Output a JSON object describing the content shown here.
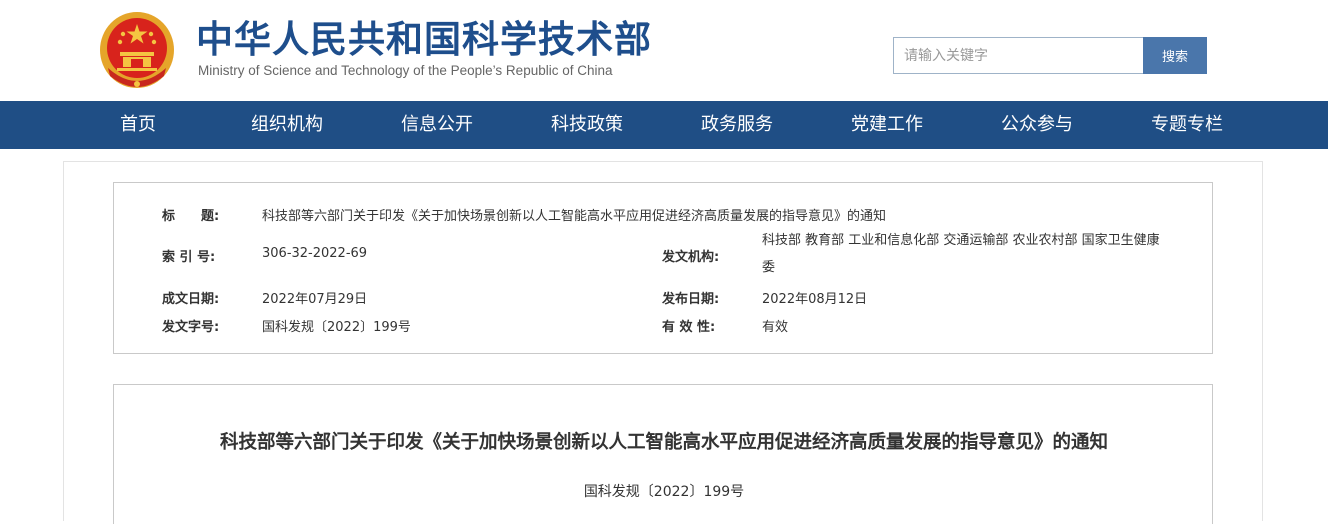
{
  "header": {
    "title_cn": "中华人民共和国科学技术部",
    "title_en": "Ministry of Science and Technology of the People’s Republic of China",
    "emblem_icon": "national-emblem-icon",
    "search_placeholder": "请输入关键字",
    "search_button": "搜索"
  },
  "colors": {
    "brand_blue": "#1e4e8c",
    "nav_bg": "#1f4e85",
    "search_button_bg": "#4a76ab"
  },
  "nav": {
    "items": [
      "首页",
      "组织机构",
      "信息公开",
      "科技政策",
      "政务服务",
      "党建工作",
      "公众参与",
      "专题专栏"
    ]
  },
  "info": {
    "title_label": "标　　题:",
    "title_value": "科技部等六部门关于印发《关于加快场景创新以人工智能高水平应用促进经济高质量发展的指导意见》的通知",
    "index_label": "索 引 号:",
    "index_value": "306-32-2022-69",
    "issuer_label": "发文机构:",
    "issuer_value": "科技部 教育部 工业和信息化部 交通运输部 农业农村部 国家卫生健康委",
    "created_label": "成文日期:",
    "created_value": "2022年07月29日",
    "published_label": "发布日期:",
    "published_value": "2022年08月12日",
    "docno_label": "发文字号:",
    "docno_value": "国科发规〔2022〕199号",
    "validity_label": "有 效 性:",
    "validity_value": "有效"
  },
  "article": {
    "title": "科技部等六部门关于印发《关于加快场景创新以人工智能高水平应用促进经济高质量发展的指导意见》的通知",
    "doc_number": "国科发规〔2022〕199号"
  }
}
